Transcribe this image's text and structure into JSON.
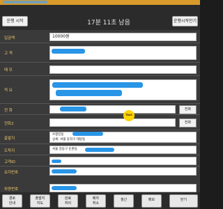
{
  "header": {
    "start_button": "운행 시작",
    "timer": "17분 11초 남음",
    "status_button": "운행시작안기"
  },
  "form": {
    "fields": [
      {
        "label": "입금액",
        "value": "10000원"
      },
      {
        "label": "고 객",
        "value": ""
      },
      {
        "label": "메 모",
        "value": ""
      },
      {
        "label": "적 요",
        "value": ""
      },
      {
        "label": "전 화",
        "value": ""
      },
      {
        "label": "전화2",
        "value": ""
      },
      {
        "label": "출발지",
        "value": "상세: 서울 동작구 대방동"
      },
      {
        "label": "도착지",
        "value": "서울 강동구 둔촌동"
      },
      {
        "label": "고객ID",
        "value": ""
      },
      {
        "label": "요지번호",
        "value": ""
      },
      {
        "label": "차량번호",
        "value": ""
      }
    ],
    "call_button_1": "전화",
    "call_button_2": "전화",
    "start_sub": "쓰정민동"
  },
  "kakao": {
    "label": "TALK"
  },
  "bottom": [
    {
      "label": "경로\n안내"
    },
    {
      "label": "출발지\n지도"
    },
    {
      "label": "완료\n처리"
    },
    {
      "label": "배차\n취소"
    },
    {
      "label": "갱신"
    },
    {
      "label": "메모"
    },
    {
      "label": "닫기"
    }
  ]
}
